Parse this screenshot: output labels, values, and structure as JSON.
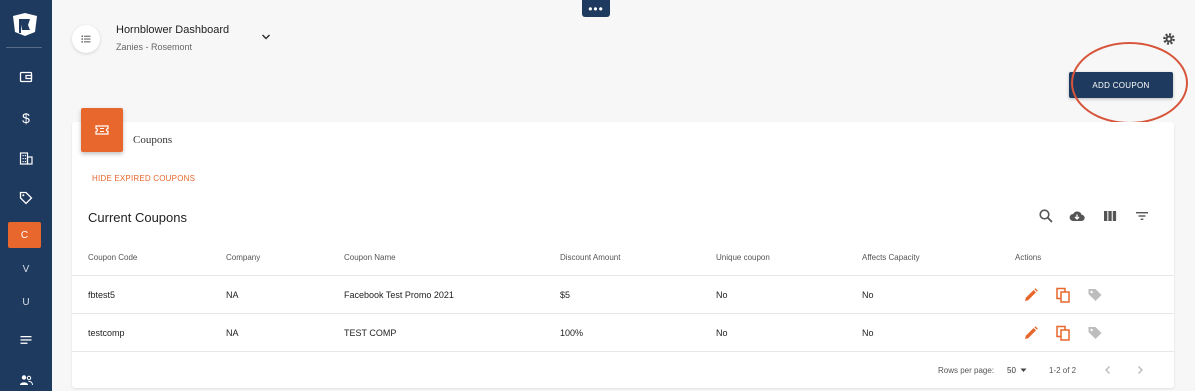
{
  "sidebar": {
    "items": [
      {
        "name": "wallet-icon"
      },
      {
        "name": "dollar-icon",
        "label": "$"
      },
      {
        "name": "building-icon"
      },
      {
        "name": "tag-icon"
      },
      {
        "label": "C"
      },
      {
        "label": "V"
      },
      {
        "label": "U"
      },
      {
        "name": "list-icon"
      },
      {
        "name": "users-icon"
      }
    ]
  },
  "top_menu": {
    "label": "•••"
  },
  "header": {
    "title": "Hornblower Dashboard",
    "subtitle": "Zanies - Rosemont"
  },
  "add_button": {
    "label": "ADD COUPON"
  },
  "card": {
    "title": "Coupons",
    "hide_expired_label": "HIDE EXPIRED COUPONS",
    "table_title": "Current Coupons"
  },
  "table": {
    "columns": [
      "Coupon Code",
      "Company",
      "Coupon Name",
      "Discount Amount",
      "Unique coupon",
      "Affects Capacity",
      "Actions"
    ],
    "rows": [
      [
        "fbtest5",
        "NA",
        "Facebook Test Promo 2021",
        "$5",
        "No",
        "No"
      ],
      [
        "testcomp",
        "NA",
        "TEST COMP",
        "100%",
        "No",
        "No"
      ]
    ]
  },
  "footer": {
    "rows_per_page_label": "Rows per page:",
    "rows_per_page_value": "50",
    "range": "1-2 of 2"
  },
  "colors": {
    "sidebar": "#1f3a5f",
    "accent": "#e8672d",
    "annotation": "#d7553a"
  }
}
